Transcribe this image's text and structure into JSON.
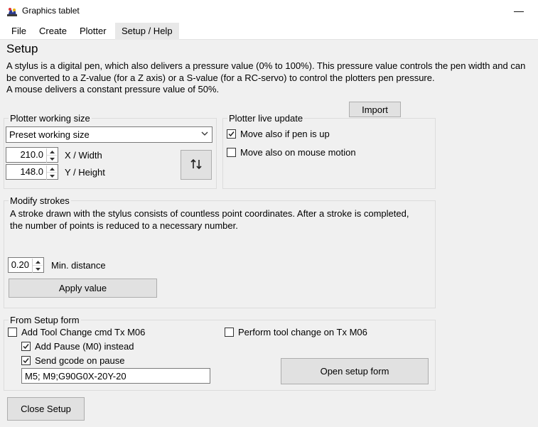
{
  "window": {
    "title": "Graphics tablet",
    "minimize_glyph": "—"
  },
  "menu": {
    "items": [
      "File",
      "Create",
      "Plotter",
      "Setup / Help"
    ]
  },
  "page": {
    "heading": "Setup",
    "description": [
      "A stylus is a digital pen, which also delivers a pressure value (0% to 100%). This pressure value controls the pen width and can",
      "be converted to a Z-value (for a Z axis) or a S-value (for a RC-servo) to control the plotters pen pressure.",
      "A mouse delivers a constant pressure value of 50%."
    ]
  },
  "import_button": "Import",
  "working_size": {
    "legend": "Plotter working size",
    "preset": "Preset working size",
    "width_value": "210.0",
    "width_label": "X / Width",
    "height_value": "148.0",
    "height_label": "Y / Height",
    "swap_icon": "swap-vertical-icon"
  },
  "live_update": {
    "legend": "Plotter live update",
    "move_pen_up": {
      "label": "Move also if pen is up",
      "checked": true
    },
    "move_mouse": {
      "label": "Move also on mouse motion",
      "checked": false
    }
  },
  "strokes": {
    "legend": "Modify strokes",
    "text": [
      "A stroke drawn with the stylus consists of countless point coordinates. After a stroke is completed,",
      "the number of points is reduced to a necessary number."
    ],
    "min_distance_value": "0.20",
    "min_distance_label": "Min. distance",
    "apply_button": "Apply value"
  },
  "setup_form": {
    "legend": "From Setup form",
    "add_tool_change": {
      "label": "Add Tool Change cmd Tx M06",
      "checked": false
    },
    "add_pause": {
      "label": "Add Pause (M0) instead",
      "checked": true
    },
    "send_gcode": {
      "label": "Send  gcode on pause",
      "checked": true
    },
    "gcode_value": "M5; M9;G90G0X-20Y-20",
    "perform_tool_change": {
      "label": "Perform tool change on Tx M06",
      "checked": false
    },
    "open_button": "Open setup form"
  },
  "close_button": "Close Setup"
}
